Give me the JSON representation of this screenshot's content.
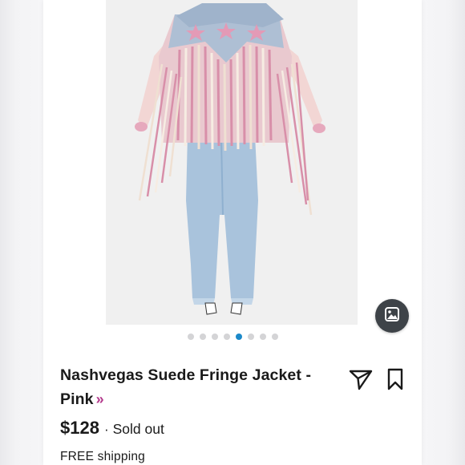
{
  "listing": {
    "title": "Nashvegas Suede Fringe Jacket - Pink",
    "brand_link_glyph": "»",
    "price": "$128",
    "separator": "·",
    "status": "Sold out",
    "shipping": "FREE shipping"
  },
  "carousel": {
    "total_images": 8,
    "active_index": 4
  },
  "icons": {
    "gallery": "image-gallery-icon",
    "share": "share-icon",
    "bookmark": "bookmark-icon"
  },
  "colors": {
    "accent_dot": "#1c89c9",
    "brand_arrow": "#b3398c",
    "gallery_button": "#3e4348",
    "text": "#1a1a1a"
  }
}
